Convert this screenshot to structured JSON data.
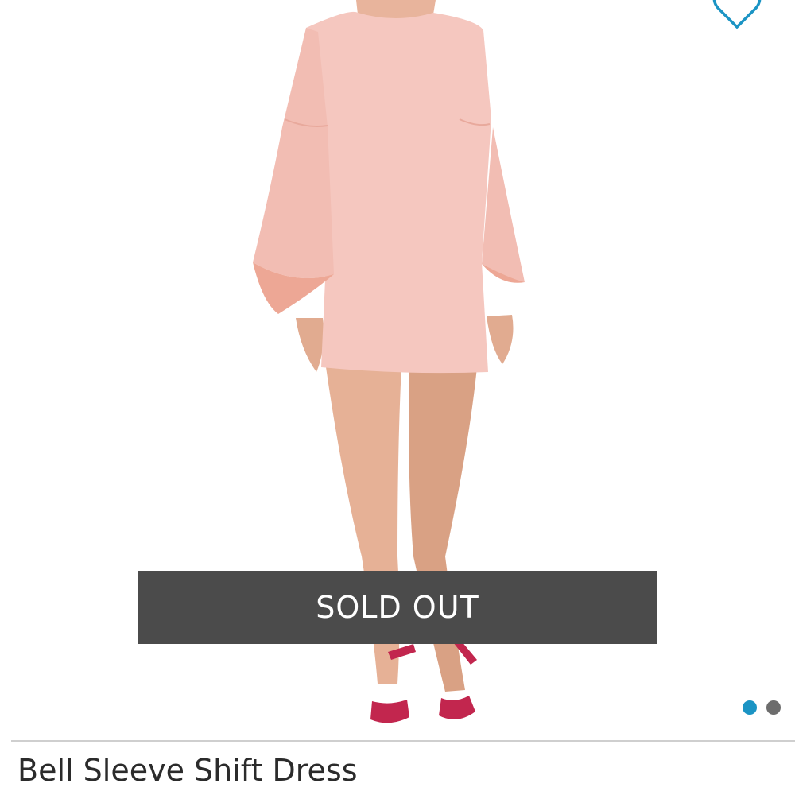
{
  "product": {
    "title": "Bell Sleeve Shift Dress",
    "status_overlay": "SOLD OUT",
    "image": {
      "description_icon": "product-photo",
      "dress_color": "#f4c4bc"
    },
    "carousel": {
      "total": 2,
      "active_index": 0,
      "active_color": "#1b94c4",
      "inactive_color": "#6d6d6d"
    }
  },
  "actions": {
    "favorite_icon": "heart-outline-icon",
    "favorite_color": "#1b94c4"
  }
}
